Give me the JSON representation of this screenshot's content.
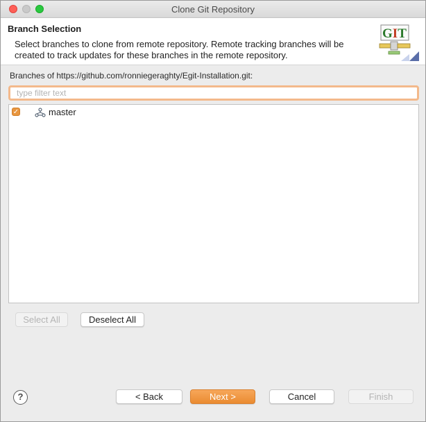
{
  "window": {
    "title": "Clone Git Repository"
  },
  "banner": {
    "title": "Branch Selection",
    "description": "Select branches to clone from remote repository. Remote tracking branches will be created to track updates for these branches in the remote repository.",
    "logo_text": "GIT"
  },
  "branches": {
    "label": "Branches of https://github.com/ronniegeraghty/Egit-Installation.git:",
    "filter_placeholder": "type filter text",
    "filter_value": "",
    "items": [
      {
        "name": "master",
        "checked": true,
        "icon": "branch-icon"
      }
    ]
  },
  "selection_buttons": {
    "select_all": "Select All",
    "deselect_all": "Deselect All"
  },
  "footer": {
    "help_icon": "question-mark-icon",
    "back": "< Back",
    "next": "Next >",
    "cancel": "Cancel",
    "finish": "Finish"
  },
  "colors": {
    "accent": "#ea8b31",
    "focus_ring": "#f3b98b",
    "checkbox": "#e8963f"
  }
}
